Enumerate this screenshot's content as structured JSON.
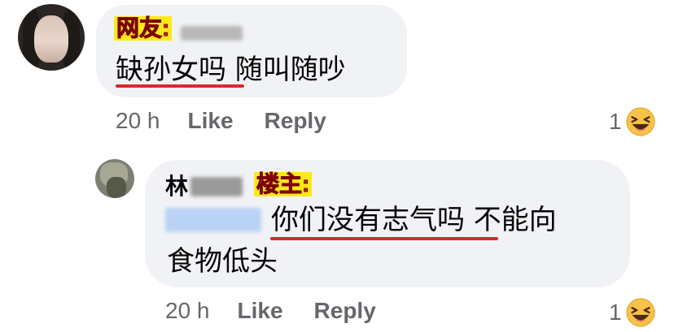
{
  "comments": [
    {
      "badge": "网友:",
      "text": "缺孙女吗 随叫随吵",
      "time": "20 h",
      "like_label": "Like",
      "reply_label": "Reply",
      "reaction_count": "1",
      "reaction_icon": "laughing-emoji"
    },
    {
      "name_visible": "林",
      "badge": "楼主:",
      "text_line1": "你们没有志气吗 不能向",
      "text_line2": "食物低头",
      "time": "20 h",
      "like_label": "Like",
      "reply_label": "Reply",
      "reaction_count": "1",
      "reaction_icon": "laughing-emoji"
    }
  ],
  "colors": {
    "bubble": "#f0f2f5",
    "meta_text": "#65676b",
    "badge_bg": "#ffe81a",
    "badge_text": "#d61e1e",
    "underline": "#e0262e",
    "mention_blur": "#b9d2f5"
  }
}
